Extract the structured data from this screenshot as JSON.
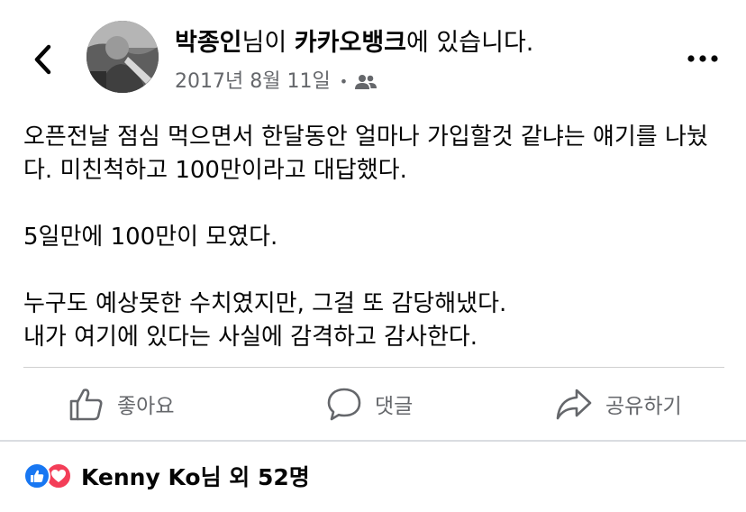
{
  "post": {
    "author_name": "박종인",
    "author_suffix": "님이 ",
    "location_name": "카카오뱅크",
    "location_suffix": "에 있습니다.",
    "date": "2017년 8월 11일",
    "audience_icon": "friends-icon",
    "body": [
      "오픈전날 점심 먹으면서 한달동안 얼마나 가입할것 같냐는 얘기를 나눴다. 미친척하고 100만이라고 대답했다.",
      "5일만에 100만이 모였다.",
      "누구도 예상못한 수치였지만, 그걸 또 감당해냈다.\n내가 여기에 있다는 사실에 감격하고 감사한다."
    ]
  },
  "actions": {
    "like_label": "좋아요",
    "comment_label": "댓글",
    "share_label": "공유하기"
  },
  "reactions": {
    "summary": "Kenny Ko님 외 52명",
    "icons": [
      "like-reaction-icon",
      "love-reaction-icon"
    ]
  },
  "colors": {
    "text_primary": "#050505",
    "text_secondary": "#65676b",
    "like_blue": "#1877f2",
    "love_red": "#f33e58",
    "divider": "#d0d0d0"
  }
}
